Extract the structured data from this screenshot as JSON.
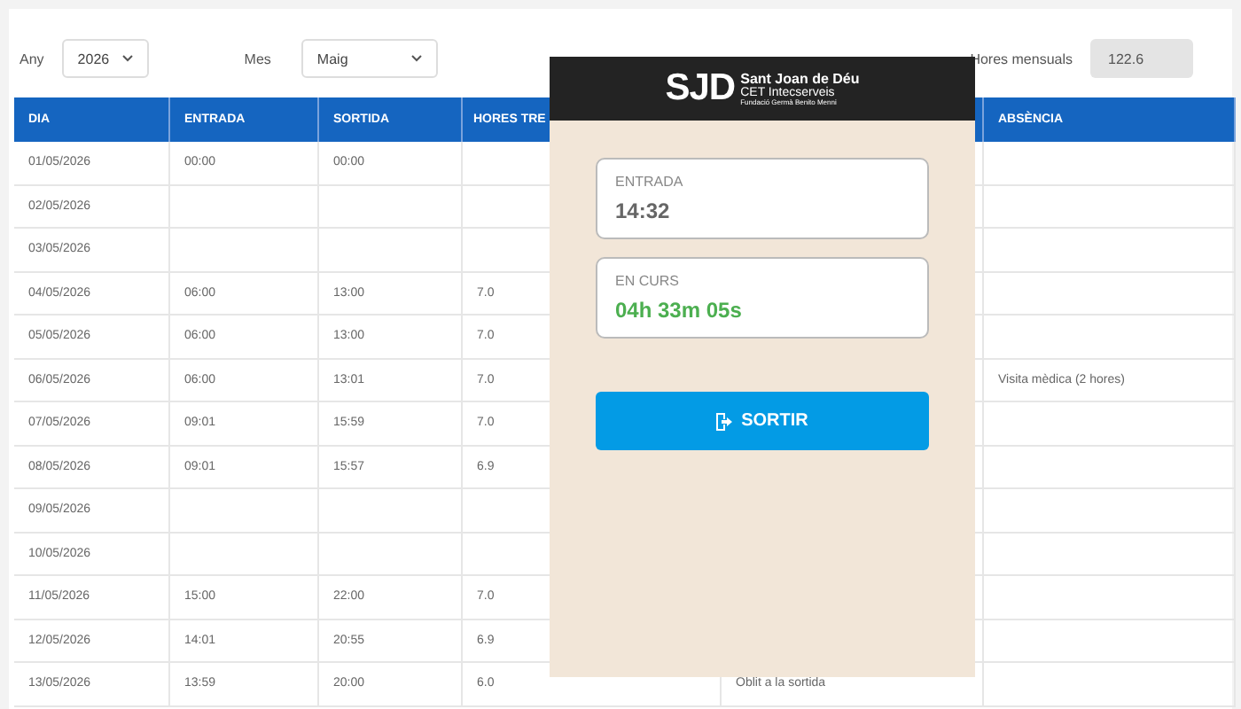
{
  "filters": {
    "year_label": "Any",
    "year": "2026",
    "month_label": "Mes",
    "month": "Maig",
    "hours_label": "Hores mensuals",
    "hours": "122.6"
  },
  "table": {
    "columns": [
      {
        "label": "DIA"
      },
      {
        "label": "ENTRADA"
      },
      {
        "label": "SORTIDA"
      },
      {
        "label": "HORES TRE"
      },
      {},
      {
        "label": "ABSÈNCIA"
      }
    ],
    "rows": [
      [
        "01/05/2026",
        "00:00",
        "00:00",
        null,
        null,
        null
      ],
      [
        "02/05/2026",
        null,
        null,
        null,
        null,
        null
      ],
      [
        "03/05/2026",
        null,
        null,
        null,
        null,
        null
      ],
      [
        "04/05/2026",
        "06:00",
        "13:00",
        "7.0",
        null,
        null
      ],
      [
        "05/05/2026",
        "06:00",
        "13:00",
        "7.0",
        null,
        null
      ],
      [
        "06/05/2026",
        "06:00",
        "13:01",
        "7.0",
        null,
        "Visita mèdica (2 hores)"
      ],
      [
        "07/05/2026",
        "09:01",
        "15:59",
        "7.0",
        null,
        null
      ],
      [
        "08/05/2026",
        "09:01",
        "15:57",
        "6.9",
        null,
        null
      ],
      [
        "09/05/2026",
        null,
        null,
        null,
        null,
        null
      ],
      [
        "10/05/2026",
        null,
        null,
        null,
        null,
        null
      ],
      [
        "11/05/2026",
        "15:00",
        "22:00",
        "7.0",
        null,
        null
      ],
      [
        "12/05/2026",
        "14:01",
        "20:55",
        "6.9",
        null,
        null
      ],
      [
        "13/05/2026",
        "13:59",
        "20:00",
        "6.0",
        "Oblit a la sortida",
        null
      ]
    ]
  },
  "panel": {
    "logo": {
      "mark": "SJD",
      "name": "Sant Joan de Déu",
      "unit": "CET Intecserveis",
      "foundation": "Fundació Germà Benito Menni"
    },
    "entry": {
      "label": "ENTRADA",
      "value": "14:32"
    },
    "running": {
      "label": "EN CURS",
      "value": "04h 33m 05s"
    },
    "button": "SORTIR"
  }
}
